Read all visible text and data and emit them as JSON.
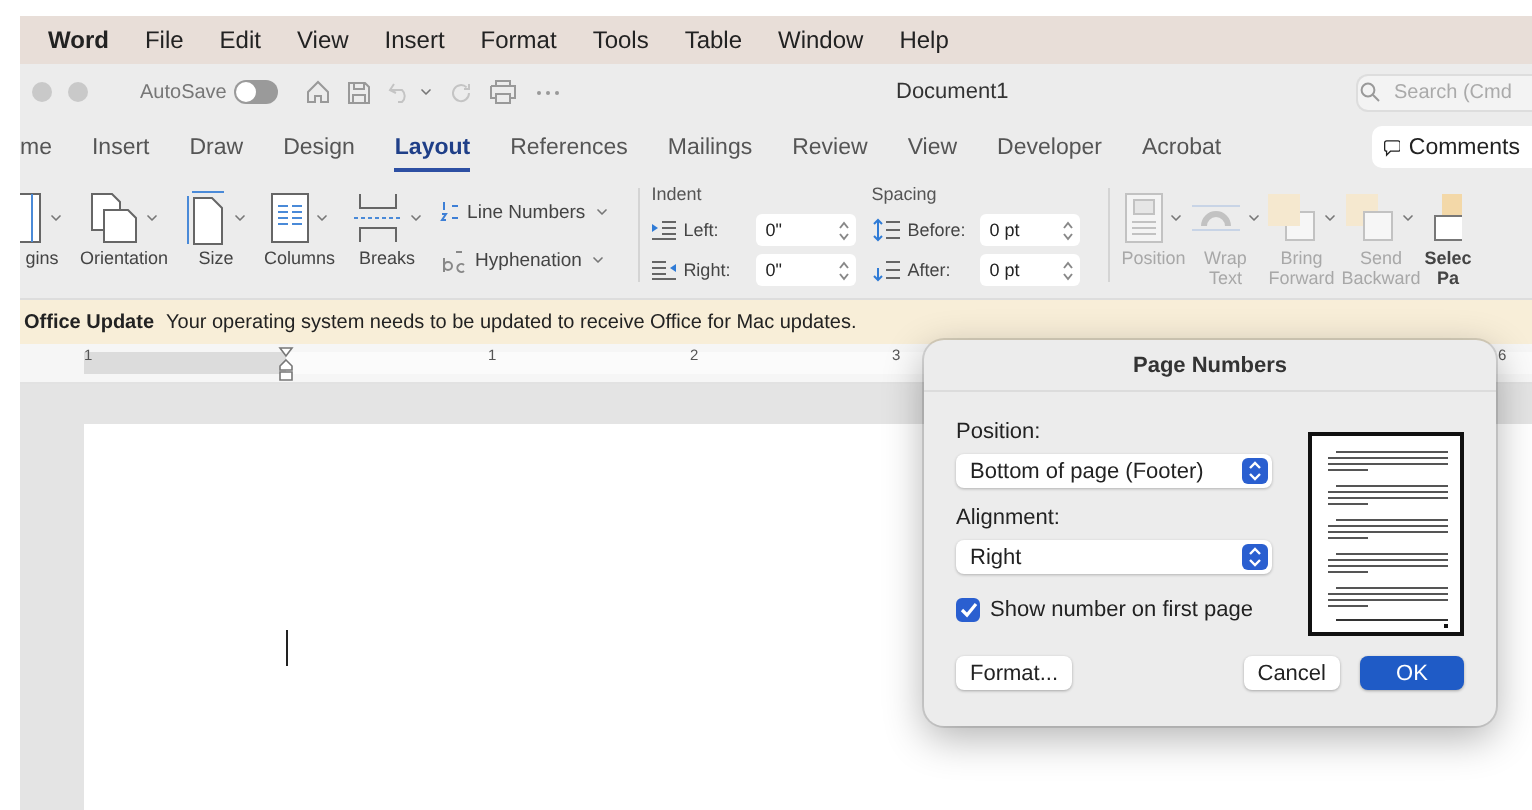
{
  "menu_bar": [
    {
      "label": "Word",
      "kind": "app"
    },
    {
      "label": "File",
      "kind": "menu"
    },
    {
      "label": "Edit",
      "kind": "menu"
    },
    {
      "label": "View",
      "kind": "menu"
    },
    {
      "label": "Insert",
      "kind": "menu"
    },
    {
      "label": "Format",
      "kind": "menu"
    },
    {
      "label": "Tools",
      "kind": "menu"
    },
    {
      "label": "Table",
      "kind": "menu"
    },
    {
      "label": "Window",
      "kind": "menu"
    },
    {
      "label": "Help",
      "kind": "menu"
    }
  ],
  "title_bar": {
    "autosave_label": "AutoSave",
    "autosave_on": false,
    "document_title": "Document1",
    "search": {
      "placeholder": "Search (Cmd"
    }
  },
  "ribbon_tabs": [
    {
      "label": "me",
      "selected": false
    },
    {
      "label": "Insert",
      "selected": false
    },
    {
      "label": "Draw",
      "selected": false
    },
    {
      "label": "Design",
      "selected": false
    },
    {
      "label": "Layout",
      "selected": true
    },
    {
      "label": "References",
      "selected": false
    },
    {
      "label": "Mailings",
      "selected": false
    },
    {
      "label": "Review",
      "selected": false
    },
    {
      "label": "View",
      "selected": false
    },
    {
      "label": "Developer",
      "selected": false
    },
    {
      "label": "Acrobat",
      "selected": false
    }
  ],
  "comments_button": "Comments",
  "ribbon": {
    "page_setup": [
      {
        "kind": "margins",
        "label": "gins"
      },
      {
        "kind": "orientation",
        "label": "Orientation"
      },
      {
        "kind": "size",
        "label": "Size"
      },
      {
        "kind": "columns",
        "label": "Columns"
      },
      {
        "kind": "breaks",
        "label": "Breaks"
      }
    ],
    "line_numbers": "Line Numbers",
    "hyphenation": "Hyphenation",
    "indent": {
      "title": "Indent",
      "fields": [
        {
          "kind": "left",
          "label": "Left:",
          "value": "0\""
        },
        {
          "kind": "right",
          "label": "Right:",
          "value": "0\""
        }
      ]
    },
    "spacing": {
      "title": "Spacing",
      "fields": [
        {
          "kind": "before",
          "label": "Before:",
          "value": "0 pt"
        },
        {
          "kind": "after",
          "label": "After:",
          "value": "0 pt"
        }
      ]
    },
    "arrange": [
      {
        "kind": "position",
        "lines": [
          "Position"
        ],
        "disabled": true
      },
      {
        "kind": "wrap",
        "lines": [
          "Wrap",
          "Text"
        ],
        "disabled": true
      },
      {
        "kind": "bring-forward",
        "lines": [
          "Bring",
          "Forward"
        ],
        "disabled": true
      },
      {
        "kind": "send-backward",
        "lines": [
          "Send",
          "Backward"
        ],
        "disabled": true
      },
      {
        "kind": "select-pane",
        "lines": [
          "Selec",
          "Pa"
        ],
        "disabled": false
      }
    ]
  },
  "notification": {
    "title": "Office Update",
    "message": "Your operating system needs to be updated to receive Office for Mac updates."
  },
  "ruler": {
    "labels": [
      "1",
      "1",
      "2",
      "3",
      "6"
    ]
  },
  "dialog": {
    "title": "Page Numbers",
    "position_label": "Position:",
    "position_value": "Bottom of page (Footer)",
    "alignment_label": "Alignment:",
    "alignment_value": "Right",
    "show_on_first_page": {
      "label": "Show number on first page",
      "checked": true
    },
    "buttons": [
      {
        "label": "Format...",
        "default": false
      },
      {
        "label": "Cancel",
        "default": false
      },
      {
        "label": "OK",
        "default": true
      }
    ]
  }
}
